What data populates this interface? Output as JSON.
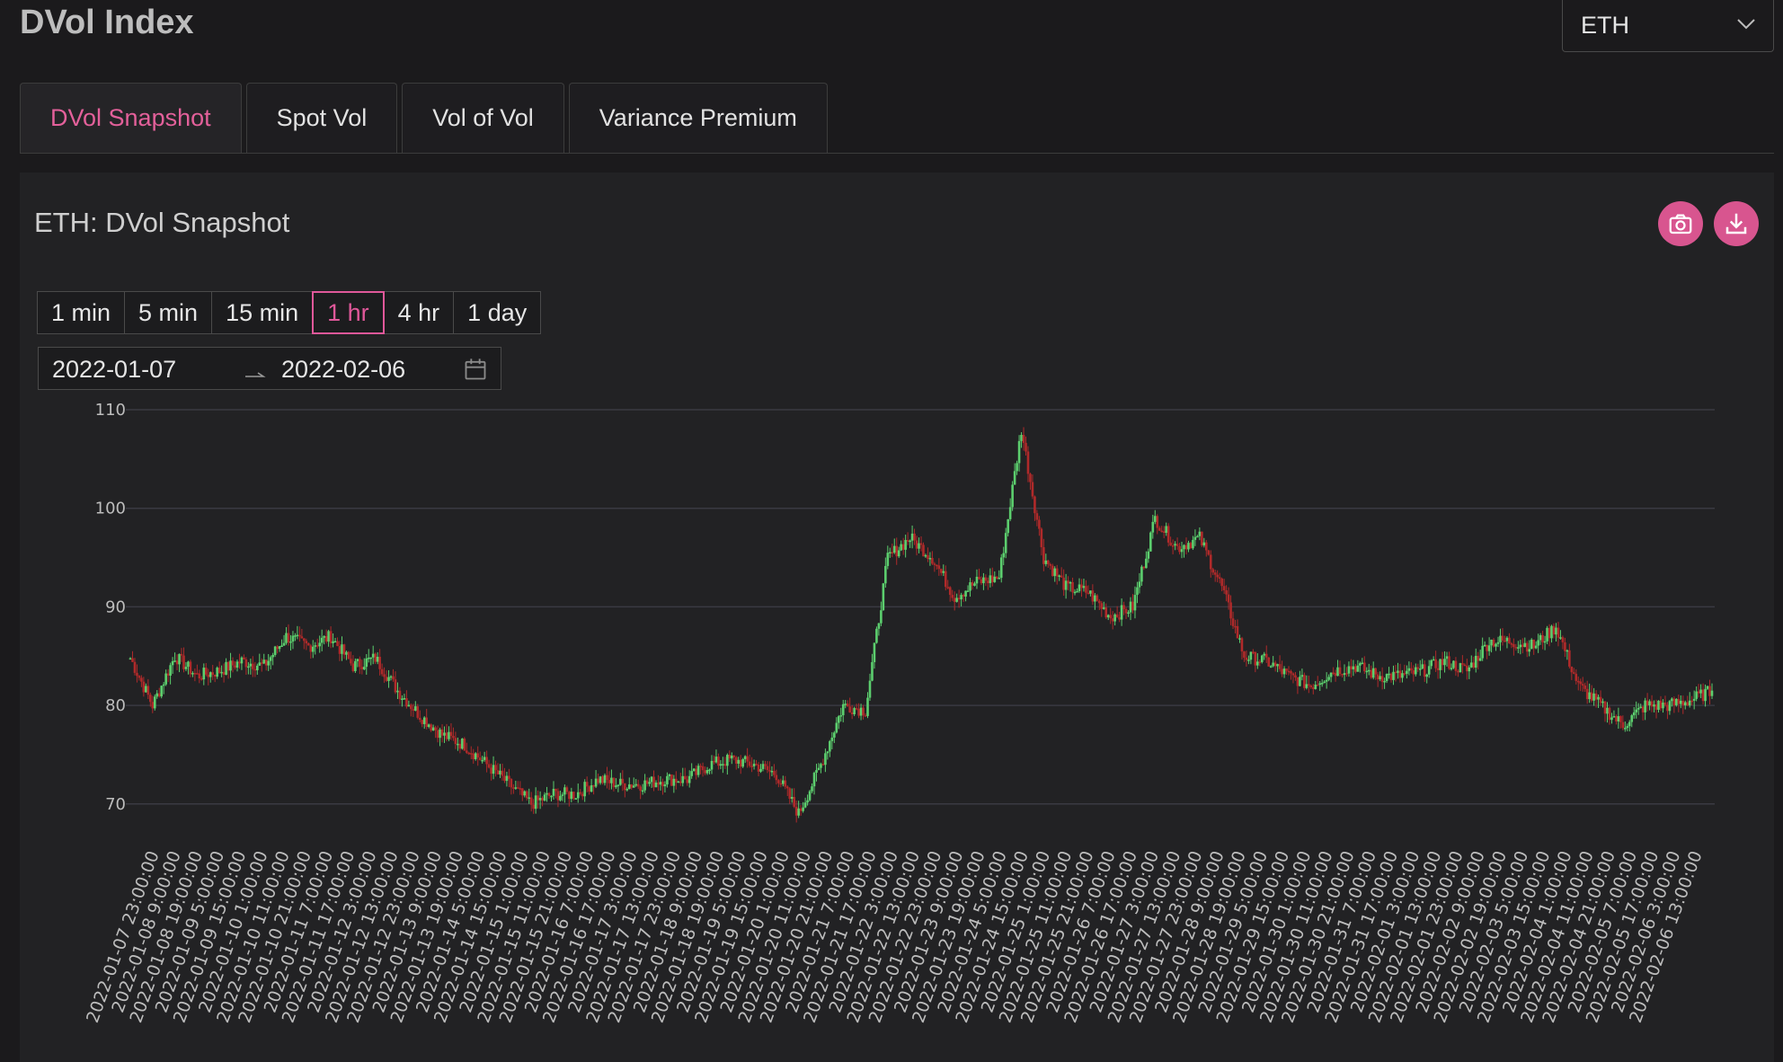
{
  "app": {
    "title": "DVol Index"
  },
  "asset_select": {
    "value": "ETH"
  },
  "tabs": [
    {
      "label": "DVol Snapshot",
      "active": true
    },
    {
      "label": "Spot Vol",
      "active": false
    },
    {
      "label": "Vol of Vol",
      "active": false
    },
    {
      "label": "Variance Premium",
      "active": false
    }
  ],
  "panel": {
    "title": "ETH: DVol Snapshot"
  },
  "icons": {
    "screenshot": "camera-icon",
    "download": "download-icon",
    "calendar": "calendar-icon",
    "select": "chevron-down-icon",
    "range_separator": "arrow-right-icon"
  },
  "intervals": [
    {
      "label": "1 min",
      "active": false
    },
    {
      "label": "5 min",
      "active": false
    },
    {
      "label": "15 min",
      "active": false
    },
    {
      "label": "1 hr",
      "active": true
    },
    {
      "label": "4 hr",
      "active": false
    },
    {
      "label": "1 day",
      "active": false
    }
  ],
  "date_range": {
    "start": "2022-01-07",
    "end": "2022-02-06"
  },
  "colors": {
    "accent": "#e0589a",
    "up": "#5ccf6e",
    "down": "#b02a2a",
    "background": "#1b1a1c",
    "grid": "#3a3a42"
  },
  "chart_data": {
    "type": "candlestick",
    "interval": "1 hr",
    "ylim": [
      67,
      110
    ],
    "yticks": [
      70,
      80,
      90,
      100,
      110
    ],
    "grid": true,
    "xticks": [
      "2022-01-07 23:00:00",
      "2022-01-08 9:00:00",
      "2022-01-08 19:00:00",
      "2022-01-09 5:00:00",
      "2022-01-09 15:00:00",
      "2022-01-10 1:00:00",
      "2022-01-10 11:00:00",
      "2022-01-10 21:00:00",
      "2022-01-11 7:00:00",
      "2022-01-11 17:00:00",
      "2022-01-12 3:00:00",
      "2022-01-12 13:00:00",
      "2022-01-12 23:00:00",
      "2022-01-13 9:00:00",
      "2022-01-13 19:00:00",
      "2022-01-14 5:00:00",
      "2022-01-14 15:00:00",
      "2022-01-15 1:00:00",
      "2022-01-15 11:00:00",
      "2022-01-15 21:00:00",
      "2022-01-16 7:00:00",
      "2022-01-16 17:00:00",
      "2022-01-17 3:00:00",
      "2022-01-17 13:00:00",
      "2022-01-17 23:00:00",
      "2022-01-18 9:00:00",
      "2022-01-18 19:00:00",
      "2022-01-19 5:00:00",
      "2022-01-19 15:00:00",
      "2022-01-20 1:00:00",
      "2022-01-20 11:00:00",
      "2022-01-20 21:00:00",
      "2022-01-21 7:00:00",
      "2022-01-21 17:00:00",
      "2022-01-22 3:00:00",
      "2022-01-22 13:00:00",
      "2022-01-22 23:00:00",
      "2022-01-23 9:00:00",
      "2022-01-23 19:00:00",
      "2022-01-24 5:00:00",
      "2022-01-24 15:00:00",
      "2022-01-25 1:00:00",
      "2022-01-25 11:00:00",
      "2022-01-25 21:00:00",
      "2022-01-26 7:00:00",
      "2022-01-26 17:00:00",
      "2022-01-27 3:00:00",
      "2022-01-27 13:00:00",
      "2022-01-27 23:00:00",
      "2022-01-28 9:00:00",
      "2022-01-28 19:00:00",
      "2022-01-29 5:00:00",
      "2022-01-29 15:00:00",
      "2022-01-30 1:00:00",
      "2022-01-30 11:00:00",
      "2022-01-30 21:00:00",
      "2022-01-31 7:00:00",
      "2022-01-31 17:00:00",
      "2022-02-01 3:00:00",
      "2022-02-01 13:00:00",
      "2022-02-01 23:00:00",
      "2022-02-02 9:00:00",
      "2022-02-02 19:00:00",
      "2022-02-03 5:00:00",
      "2022-02-03 15:00:00",
      "2022-02-04 1:00:00",
      "2022-02-04 11:00:00",
      "2022-02-04 21:00:00",
      "2022-02-05 7:00:00",
      "2022-02-05 17:00:00",
      "2022-02-06 3:00:00",
      "2022-02-06 13:00:00"
    ],
    "closes_per_tick": [
      84.8,
      80.0,
      85.0,
      83.0,
      83.5,
      84.5,
      84.0,
      87.0,
      86.0,
      87.0,
      84.0,
      84.8,
      81.5,
      79.0,
      77.0,
      76.0,
      74.0,
      72.0,
      70.0,
      71.0,
      71.0,
      72.5,
      72.0,
      72.0,
      72.5,
      72.5,
      74.0,
      74.5,
      74.0,
      73.0,
      69.0,
      74.0,
      80.0,
      79.5,
      95.0,
      97.0,
      95.0,
      91.0,
      92.5,
      93.0,
      108.0,
      95.0,
      92.0,
      91.5,
      89.0,
      90.0,
      99.0,
      96.0,
      97.0,
      92.0,
      85.0,
      84.5,
      83.0,
      82.0,
      83.5,
      84.0,
      83.0,
      83.0,
      83.5,
      84.5,
      83.5,
      86.5,
      86.5,
      86.0,
      88.0,
      82.0,
      80.0,
      78.0,
      80.0,
      80.0,
      80.5,
      81.5
    ]
  }
}
